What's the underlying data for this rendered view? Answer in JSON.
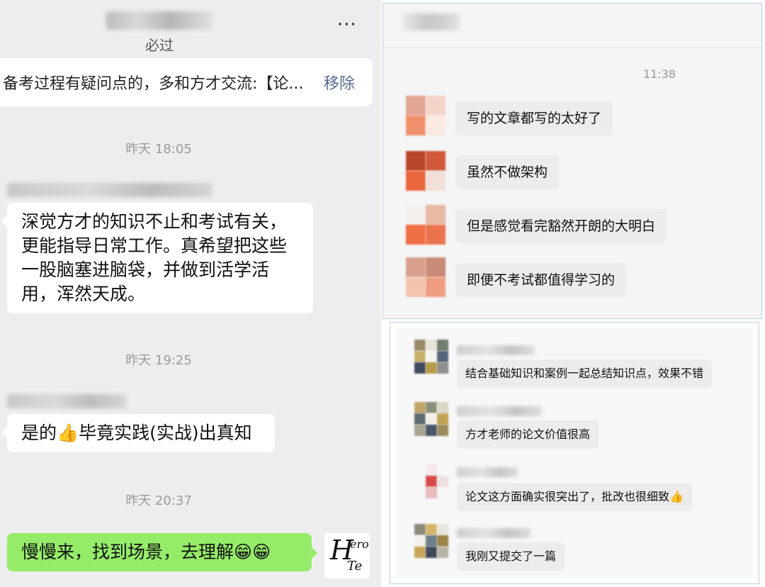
{
  "left_chat": {
    "header": {
      "subtitle": "必过",
      "more_label": "···"
    },
    "pinned": {
      "text": "备考过程有疑问点的，多和方才交流:【论...",
      "action": "移除"
    },
    "messages": [
      {
        "time": "昨天 18:05",
        "sender": "theirs",
        "text": "深觉方才的知识不止和考试有关，更能指导日常工作。真希望把这些一股脑塞进脑袋，并做到活学活用，浑然天成。"
      },
      {
        "time": "昨天 19:25",
        "sender": "theirs",
        "text": "是的👍毕竟实践(实战)出真知"
      },
      {
        "time": "昨天 20:37",
        "sender": "mine",
        "text": "慢慢来，找到场景，去理解😁😁"
      }
    ],
    "my_avatar": {
      "line1": "H",
      "line2": "ero",
      "line3": "Te"
    }
  },
  "top_right_chat": {
    "time": "11:38",
    "messages": [
      "写的文章都写的太好了",
      "虽然不做架构",
      "但是感觉看完豁然开朗的大明白",
      "即便不考试都值得学习的"
    ]
  },
  "bottom_right_chat": {
    "messages": [
      "结合基础知识和案例一起总结知识点，效果不错",
      "方才老师的论文价值很高",
      "论文这方面确实很突出了，批改也很细致👍",
      "我刚又提交了一篇"
    ]
  },
  "colors": {
    "left_bg": "#ededed",
    "my_bubble": "#95ec69",
    "link": "#576b95",
    "panel_border": "#b9cfe8"
  }
}
